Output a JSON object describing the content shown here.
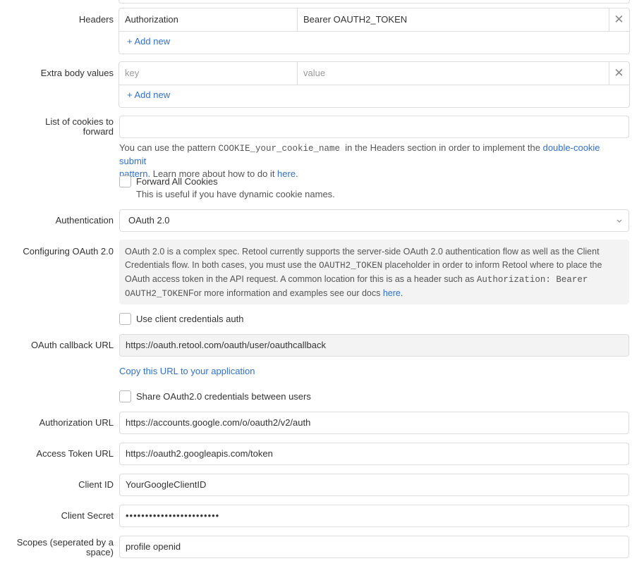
{
  "headers": {
    "label": "Headers",
    "rows": [
      {
        "key": "Authorization",
        "value": "Bearer OAUTH2_TOKEN"
      }
    ],
    "add_new": "+ Add new"
  },
  "extra_body": {
    "label": "Extra body values",
    "key_placeholder": "key",
    "value_placeholder": "value",
    "add_new": "+ Add new"
  },
  "cookies": {
    "label_line1": "List of cookies to",
    "label_line2": "forward",
    "value": "",
    "help_pre": "You can use the pattern ",
    "help_code": "COOKIE_your_cookie_name",
    "help_mid": "  in the Headers section in order to implement the ",
    "help_link1_a": "double-cookie submit",
    "help_link1_b": "pattern",
    "help_post": ". Learn more about how to do it ",
    "help_link2": "here",
    "help_end": ".",
    "forward_all_label": "Forward All Cookies",
    "forward_all_help": "This is useful if you have dynamic cookie names.",
    "forward_all_checked": false
  },
  "authentication": {
    "label": "Authentication",
    "selected": "OAuth 2.0",
    "chevron_icon": "chevron-down-icon"
  },
  "oauth_info": {
    "label": "Configuring OAuth 2.0",
    "line1": "OAuth 2.0 is a complex spec. Retool currently supports the server-side OAuth 2.0 authentication flow as well as the Client",
    "line2_pre": "Credentials flow. In both cases, you must use the ",
    "line2_code": "OAUTH2_TOKEN",
    "line2_post": " placeholder in order to inform Retool where to place the",
    "line3_pre": "OAuth access token in the API request. A common location for this is as a header such as ",
    "line3_code": "Authorization: Bearer",
    "line4_code": "OAUTH2_TOKEN",
    "line4_post": "For more information and examples see our docs ",
    "line4_link": "here",
    "line4_end": "."
  },
  "client_credentials": {
    "label": "Use client credentials auth",
    "checked": false
  },
  "callback": {
    "label": "OAuth callback URL",
    "value": "https://oauth.retool.com/oauth/user/oauthcallback",
    "copy_link": "Copy this URL to your application"
  },
  "share_credentials": {
    "label": "Share OAuth2.0 credentials between users",
    "checked": false
  },
  "auth_url": {
    "label": "Authorization URL",
    "value": "https://accounts.google.com/o/oauth2/v2/auth"
  },
  "token_url": {
    "label": "Access Token URL",
    "value": "https://oauth2.googleapis.com/token"
  },
  "client_id": {
    "label": "Client ID",
    "value": "YourGoogleClientID"
  },
  "client_secret": {
    "label": "Client Secret",
    "value": "••••••••••••••••••••••••"
  },
  "scopes": {
    "label_line1": "Scopes (seperated by a",
    "label_line2": "space)",
    "value": "profile openid"
  },
  "colors": {
    "link": "#3172c4",
    "border": "#dcdcdc",
    "readonly_bg": "#f3f3f3"
  }
}
